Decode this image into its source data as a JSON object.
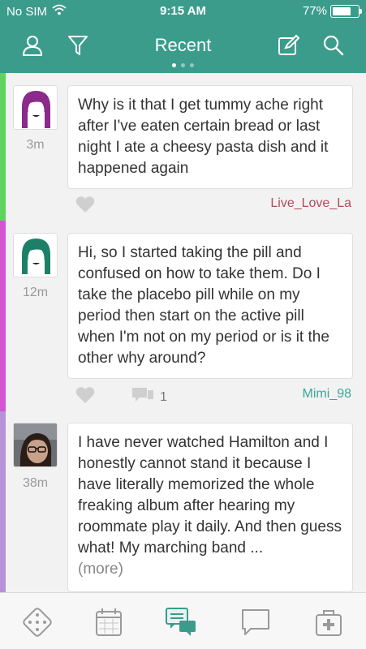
{
  "status": {
    "carrier": "No SIM",
    "time": "9:15 AM",
    "battery_text": "77%",
    "battery_level": 0.77
  },
  "nav": {
    "title": "Recent",
    "page_count": 3,
    "active_page": 0
  },
  "colors": {
    "header": "#3b9c8c",
    "stripe_green": "#5fd35e",
    "stripe_magenta": "#d454d6",
    "stripe_lavender": "#b692d8"
  },
  "posts": [
    {
      "age": "3m",
      "text": "Why is it that I get tummy ache right after I've eaten certain bread or last night I ate a cheesy pasta dish and it happened again",
      "author": "Live_Love_La",
      "author_color": "#b04a5a",
      "comment_count": "",
      "avatar_icon": "purple-hair-avatar-icon"
    },
    {
      "age": "12m",
      "text": "Hi, so I started taking the pill and confused on how to take them. Do I take the placebo pill while on my period then start on the active pill when I'm not on my period or is it the other why around?",
      "author": "Mimi_98",
      "author_color": "#3aa89a",
      "comment_count": "1",
      "avatar_icon": "green-hair-avatar-icon"
    },
    {
      "age": "38m",
      "text": "I have never watched Hamilton and I honestly cannot stand it because I have literally memorized the whole freaking album after hearing my roommate play it daily. And then guess what! My marching band  ...",
      "more_label": "(more)",
      "avatar_icon": "photo-avatar-icon"
    }
  ],
  "tabs": [
    {
      "icon": "dice-icon"
    },
    {
      "icon": "calendar-icon"
    },
    {
      "icon": "chat-bubbles-icon",
      "active": true
    },
    {
      "icon": "message-icon"
    },
    {
      "icon": "first-aid-kit-icon"
    }
  ]
}
